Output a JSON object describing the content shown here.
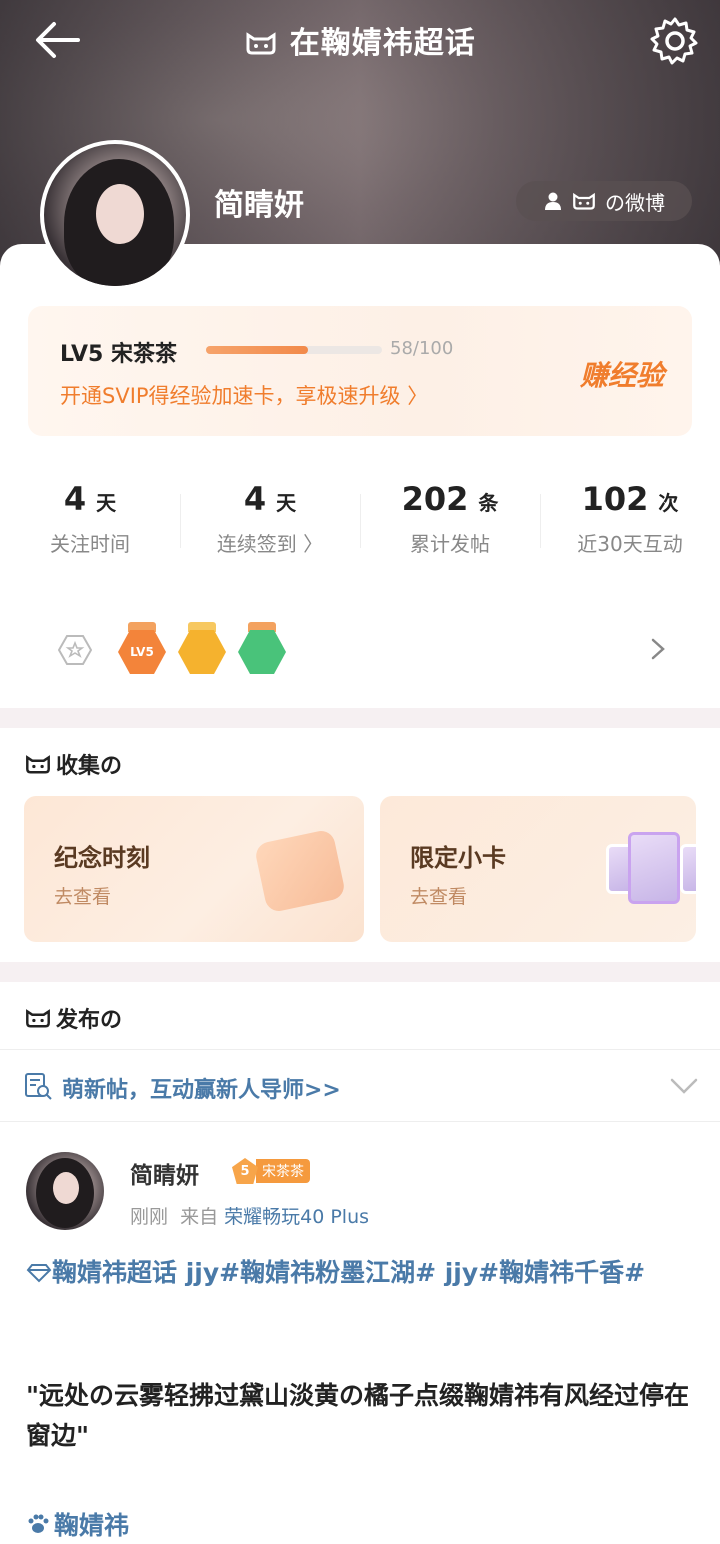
{
  "header": {
    "title_prefix_icon": "cat-face-icon",
    "title": "在鞠婧祎超话",
    "back_icon": "back-arrow-icon",
    "settings_icon": "gear-icon"
  },
  "profile": {
    "username": "简睛妍",
    "weibo_button_label": "の微博",
    "weibo_icons": [
      "person-icon",
      "cat-face-icon"
    ]
  },
  "level": {
    "label": "LV5  宋茶茶",
    "progress_text": "58/100",
    "progress_fraction": 0.58,
    "promo": "开通SVIP得经验加速卡，享极速升级 〉",
    "earn_button": "赚经验"
  },
  "stats": [
    {
      "value": "4",
      "unit": "天",
      "label": "关注时间"
    },
    {
      "value": "4",
      "unit": "天",
      "label": "连续签到 〉"
    },
    {
      "value": "202",
      "unit": "条",
      "label": "累计发帖"
    },
    {
      "value": "102",
      "unit": "次",
      "label": "近30天互动"
    }
  ],
  "medals": [
    {
      "text": "LV5",
      "color": "#f3843a"
    },
    {
      "text": "",
      "color": "#f5b22e"
    },
    {
      "text": "",
      "color": "#49c37a"
    }
  ],
  "collect": {
    "title": "收集の",
    "cards": [
      {
        "title": "纪念时刻",
        "sub": "去查看"
      },
      {
        "title": "限定小卡",
        "sub": "去查看"
      }
    ]
  },
  "publish": {
    "title": "发布の",
    "notice": "萌新帖，互动赢新人导师>>"
  },
  "post": {
    "author": "简睛妍",
    "badge_level": "5",
    "badge_text": "宋茶茶",
    "time": "刚刚",
    "from_label": "来自",
    "source": "荣耀畅玩40 Plus",
    "topics": "鞠婧祎超话   jjy#鞠婧祎粉墨江湖# jjy#鞠婧祎千香#",
    "quote": "\"远处の云雾轻拂过黛山淡黄の橘子点缀鞠婧祎有风经过停在窗边\"",
    "tag": "鞠婧祎"
  },
  "colors": {
    "accent_orange": "#f07d2d",
    "link_blue": "#4a7aa8"
  }
}
